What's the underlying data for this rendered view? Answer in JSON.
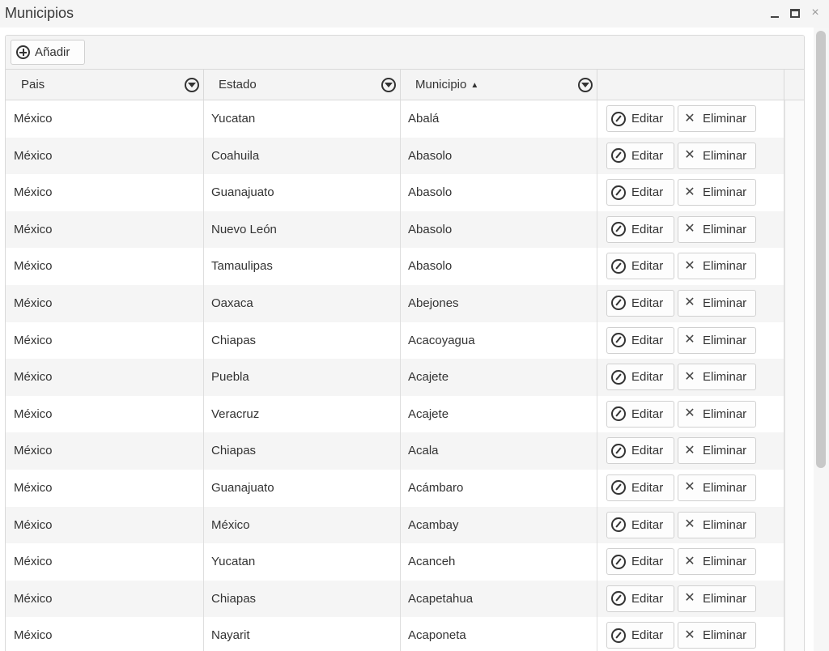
{
  "window": {
    "title": "Municipios",
    "controls": {
      "minimize": "_",
      "maximize": "□",
      "close": "×"
    }
  },
  "toolbar": {
    "add_label": "Añadir"
  },
  "columns": [
    {
      "label": "Pais",
      "sort": ""
    },
    {
      "label": "Estado",
      "sort": ""
    },
    {
      "label": "Municipio",
      "sort": "▲"
    },
    {
      "label": ""
    }
  ],
  "actions": {
    "edit_label": "Editar",
    "delete_label": "Eliminar"
  },
  "rows": [
    {
      "pais": "México",
      "estado": "Yucatan",
      "municipio": "Abalá"
    },
    {
      "pais": "México",
      "estado": "Coahuila",
      "municipio": "Abasolo"
    },
    {
      "pais": "México",
      "estado": "Guanajuato",
      "municipio": "Abasolo"
    },
    {
      "pais": "México",
      "estado": "Nuevo León",
      "municipio": "Abasolo"
    },
    {
      "pais": "México",
      "estado": "Tamaulipas",
      "municipio": "Abasolo"
    },
    {
      "pais": "México",
      "estado": "Oaxaca",
      "municipio": "Abejones"
    },
    {
      "pais": "México",
      "estado": "Chiapas",
      "municipio": "Acacoyagua"
    },
    {
      "pais": "México",
      "estado": "Puebla",
      "municipio": "Acajete"
    },
    {
      "pais": "México",
      "estado": "Veracruz",
      "municipio": "Acajete"
    },
    {
      "pais": "México",
      "estado": "Chiapas",
      "municipio": "Acala"
    },
    {
      "pais": "México",
      "estado": "Guanajuato",
      "municipio": "Acámbaro"
    },
    {
      "pais": "México",
      "estado": "México",
      "municipio": "Acambay"
    },
    {
      "pais": "México",
      "estado": "Yucatan",
      "municipio": "Acanceh"
    },
    {
      "pais": "México",
      "estado": "Chiapas",
      "municipio": "Acapetahua"
    },
    {
      "pais": "México",
      "estado": "Nayarit",
      "municipio": "Acaponeta"
    }
  ]
}
